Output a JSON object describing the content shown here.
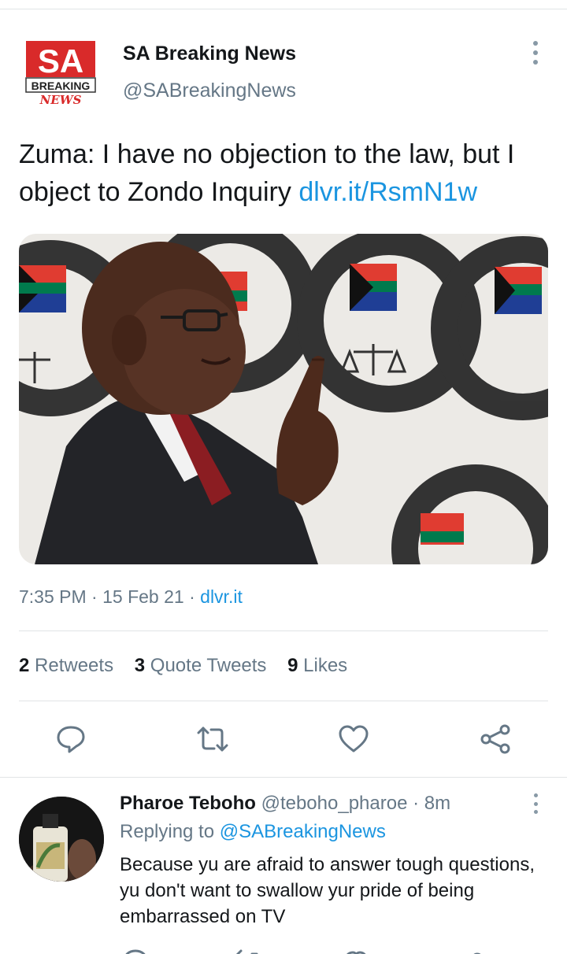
{
  "tweet": {
    "author_name": "SA Breaking News",
    "author_handle": "@SABreakingNews",
    "logo": {
      "top_text": "SA",
      "mid_text": "BREAKING",
      "bottom_text": "NEWS",
      "icon": "sa-breaking-news-logo"
    },
    "text": "Zuma: I have no objection to the law, but I object to Zondo Inquiry ",
    "link_text": "dlvr.it/RsmN1w",
    "media_icon": "photo-zuma-at-inquiry",
    "time": "7:35 PM",
    "separator": "·",
    "date": "15 Feb 21",
    "source": "dlvr.it",
    "stats": {
      "retweets_count": "2",
      "retweets_label": "Retweets",
      "quote_count": "3",
      "quote_label": "Quote Tweets",
      "likes_count": "9",
      "likes_label": "Likes"
    },
    "actions": [
      "reply-icon",
      "retweet-icon",
      "like-icon",
      "share-icon"
    ]
  },
  "reply": {
    "name": "Pharoe Teboho",
    "handle": "@teboho_pharoe",
    "separator": "·",
    "time": "8m",
    "replying_label": "Replying to",
    "replying_to": "@SABreakingNews",
    "text": "Because yu are afraid to answer tough questions, yu don't want to swallow yur pride of being embarrassed on TV"
  },
  "colors": {
    "link": "#1b95e0",
    "secondary_text": "#657786",
    "primary_text": "#14171a",
    "divider": "#e1e4e6",
    "logo_red": "#d92a2a"
  }
}
